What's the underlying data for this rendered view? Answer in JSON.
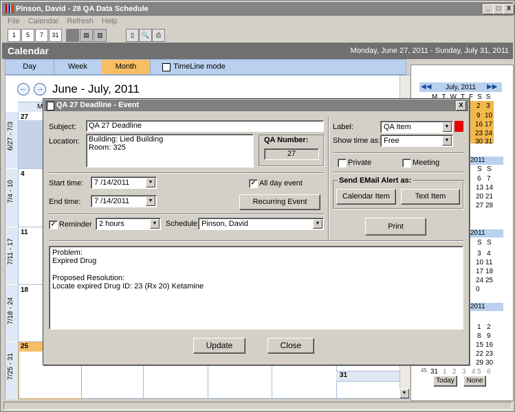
{
  "window": {
    "title": "Pinson, David - 28 QA Data Schedule",
    "min": "_",
    "max": "□",
    "close": "X"
  },
  "menu": [
    "File",
    "Calendar",
    "Refresh",
    "Help"
  ],
  "toolbar": {
    "day": "1",
    "workweek": "5",
    "week": "7",
    "month": "31"
  },
  "calendar_header": {
    "title": "Calendar",
    "range": "Monday, June 27, 2011 - Sunday, July 31, 2011"
  },
  "tabs": {
    "day": "Day",
    "week": "Week",
    "month": "Month",
    "timeline": "TimeLine mode"
  },
  "calendar": {
    "range_title": "June - July, 2011",
    "prev": "←",
    "next": "→",
    "col_header": "M",
    "weeks": [
      {
        "label": "6/27 - 7/3",
        "day": "27"
      },
      {
        "label": "7/4 - 10",
        "day": "4"
      },
      {
        "label": "7/11 - 17",
        "day": "11"
      },
      {
        "label": "7/18 - 24",
        "day": "18"
      },
      {
        "label": "7/25 - 31",
        "day": "25"
      }
    ],
    "last_day": "31"
  },
  "mini_cal": {
    "month1": "July, 2011",
    "dow": [
      "M",
      "T",
      "W",
      "T",
      "F",
      "S",
      "S"
    ],
    "row1_tail": [
      "2",
      "3"
    ],
    "rows": [
      [
        "9",
        "10"
      ],
      [
        "16",
        "17"
      ],
      [
        "23",
        "24"
      ],
      [
        "30",
        "31"
      ]
    ],
    "ss_headers": [
      "S",
      "S"
    ],
    "month2_tail": "2011",
    "week_ss": [
      [
        "6",
        "7"
      ],
      [
        "13",
        "14"
      ],
      [
        "20",
        "21"
      ],
      [
        "27",
        "28"
      ]
    ],
    "month3_tail": "2011",
    "week3": [
      [
        "3",
        "4"
      ],
      [
        "10",
        "11"
      ],
      [
        "17",
        "18"
      ],
      [
        "24",
        "25"
      ],
      [
        "0",
        ""
      ]
    ],
    "month4_tail": "2011",
    "week4": [
      [
        "1",
        "2"
      ],
      [
        "8",
        "9"
      ],
      [
        "15",
        "16"
      ],
      [
        "22",
        "23"
      ],
      [
        "29",
        "30"
      ],
      [
        "5",
        "6"
      ]
    ],
    "weekno": "45",
    "first": "31",
    "nums_last": [
      "1",
      "2",
      "3",
      "4"
    ],
    "today_btn": "Today",
    "none_btn": "None"
  },
  "dialog": {
    "title": "QA 27 Deadline - Event",
    "subject_label": "Subject:",
    "subject": "QA 27 Deadline",
    "location_label": "Location:",
    "location_line1": "Building: Lied Building",
    "location_line2": "Room: 325",
    "qa_number_label": "QA Number:",
    "qa_number": "27",
    "label_label": "Label:",
    "label_value": "QA Item",
    "label_color": "#e80000",
    "show_time_label": "Show time as:",
    "show_time_value": "Free",
    "private_label": "Private",
    "meeting_label": "Meeting",
    "email_group_label": "Send EMail Alert as:",
    "calendar_item_btn": "Calendar Item",
    "text_item_btn": "Text Item",
    "print_btn": "Print",
    "start_label": "Start time:",
    "start_value": "7 /14/2011",
    "end_label": "End time:",
    "end_value": "7 /14/2011",
    "all_day_label": "All day event",
    "all_day_checked": "✓",
    "recurring_btn": "Recurring Event",
    "reminder_label": "Reminder",
    "reminder_checked": "✓",
    "reminder_value": "2 hours",
    "schedule_label": "Schedule:",
    "schedule_value": "Pinson, David",
    "notes": [
      "Problem:",
      "Expired Drug",
      "",
      "Proposed Resolution:",
      "Locate expired Drug ID: 23 (Rx 20) Ketamine"
    ],
    "update_btn": "Update",
    "close_btn": "Close"
  }
}
